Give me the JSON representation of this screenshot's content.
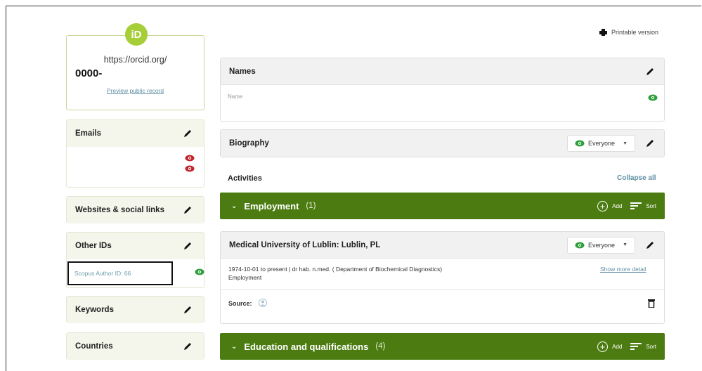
{
  "sidebar": {
    "id_logo_text": "iD",
    "orcid_url": "https://orcid.org/",
    "orcid_number": "0000-",
    "preview_link": "Preview public record",
    "emails_title": "Emails",
    "websites_title": "Websites & social links",
    "other_ids_title": "Other IDs",
    "scopus_label": "Scopus Author ID: 66",
    "keywords_title": "Keywords",
    "countries_title": "Countries"
  },
  "header": {
    "printable_label": "Printable version"
  },
  "names": {
    "title": "Names",
    "field_label": "Name"
  },
  "biography": {
    "title": "Biography",
    "visibility": "Everyone"
  },
  "activities": {
    "title": "Activities",
    "collapse_all": "Collapse all"
  },
  "employment": {
    "title": "Employment",
    "count": "(1)",
    "add_label": "Add",
    "sort_label": "Sort",
    "item": {
      "org": "Medical University of Lublin: Lublin, PL",
      "visibility": "Everyone",
      "dates_role": "1974-10-01 to present | dr hab. n.med. ( Department of Biochemical Diagnostics)",
      "type": "Employment",
      "show_more": "Show more detail",
      "source_label": "Source:"
    }
  },
  "education": {
    "title": "Education and qualifications",
    "count": "(4)",
    "add_label": "Add",
    "sort_label": "Sort"
  },
  "colors": {
    "accent_green": "#4c7c11",
    "orcid_green": "#a6ce39",
    "eye_green": "#2e9e3a",
    "eye_red": "#c0262d",
    "link_blue": "#5f8fa3"
  }
}
